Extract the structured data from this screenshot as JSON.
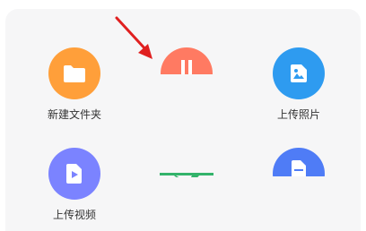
{
  "sheet": {
    "tiles": [
      {
        "label": "新建文件夹",
        "icon": "folder-icon",
        "color": "#ff9f3a"
      },
      {
        "label": "",
        "icon": "upload-doc-icon",
        "color": "#ff7a62"
      },
      {
        "label": "上传照片",
        "icon": "image-icon",
        "color": "#2e9bf0"
      },
      {
        "label": "上传视频",
        "icon": "video-icon",
        "color": "#7b83ff"
      },
      {
        "label": "",
        "icon": "green-icon",
        "color": "#33b36b"
      },
      {
        "label": "",
        "icon": "document-icon",
        "color": "#4f7cf6"
      }
    ]
  },
  "annotation": {
    "arrow_color": "#e02020"
  }
}
